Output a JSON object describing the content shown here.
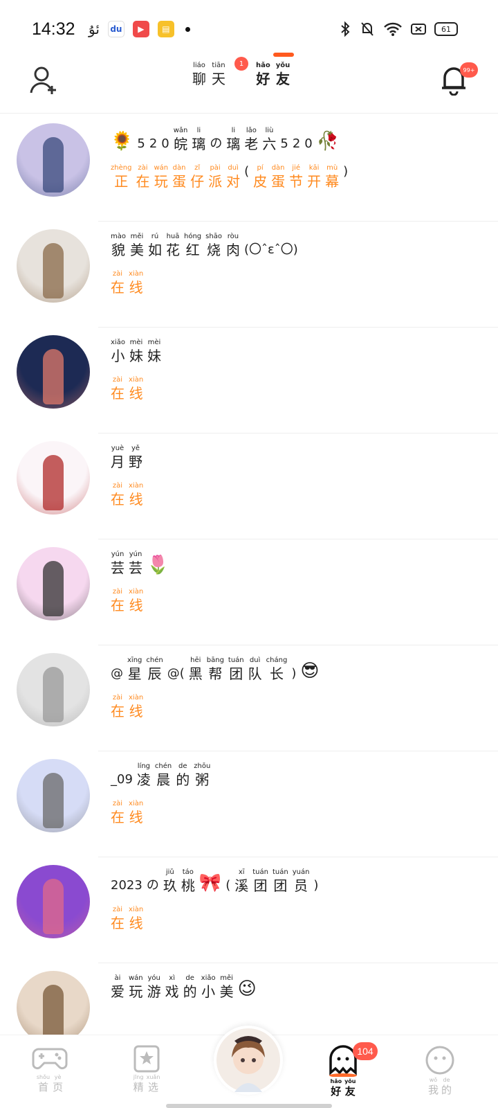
{
  "status_bar": {
    "time": "14:32",
    "left_icons": [
      "uyghur-app-icon",
      "baidu-icon",
      "video-app-icon",
      "notes-app-icon",
      "more-dot-icon"
    ],
    "right_icons": [
      "bluetooth-icon",
      "mute-bell-icon",
      "wifi-icon",
      "sim-disabled-icon"
    ],
    "battery": "61"
  },
  "header": {
    "tab_chat": [
      {
        "py": "liáo",
        "hz": "聊"
      },
      {
        "py": "tiān",
        "hz": "天"
      }
    ],
    "tab_friends": [
      {
        "py": "hǎo",
        "hz": "好"
      },
      {
        "py": "yǒu",
        "hz": "友"
      }
    ],
    "chat_badge": "1",
    "bell_badge": "99+",
    "accent": "#ff5a1f"
  },
  "friends": [
    {
      "name": [
        {
          "emoji": "🌻"
        },
        {
          "text": "5"
        },
        {
          "text": "2"
        },
        {
          "text": "0"
        },
        {
          "py": "wǎn",
          "hz": "皖"
        },
        {
          "py": "li",
          "hz": "璃"
        },
        {
          "text": "の"
        },
        {
          "py": "li",
          "hz": "璃"
        },
        {
          "py": "lǎo",
          "hz": "老"
        },
        {
          "py": "liù",
          "hz": "六"
        },
        {
          "text": "5"
        },
        {
          "text": "2"
        },
        {
          "text": "0"
        },
        {
          "emoji": "🥀"
        }
      ],
      "status": [
        {
          "py": "zhèng",
          "hz": "正"
        },
        {
          "py": "zài",
          "hz": "在"
        },
        {
          "py": "wán",
          "hz": "玩"
        },
        {
          "py": "dàn",
          "hz": "蛋"
        },
        {
          "py": "zǐ",
          "hz": "仔"
        },
        {
          "py": "pài",
          "hz": "派"
        },
        {
          "py": "duì",
          "hz": "对"
        },
        {
          "text": "("
        },
        {
          "py": "pí",
          "hz": "皮"
        },
        {
          "py": "dàn",
          "hz": "蛋"
        },
        {
          "py": "jié",
          "hz": "节"
        },
        {
          "py": "kāi",
          "hz": "开"
        },
        {
          "py": "mù",
          "hz": "幕"
        },
        {
          "text": ")"
        }
      ],
      "avatar_colors": [
        "#c9c2e6",
        "#3a4a7c"
      ]
    },
    {
      "name": [
        {
          "py": "mào",
          "hz": "貌"
        },
        {
          "py": "měi",
          "hz": "美"
        },
        {
          "py": "rú",
          "hz": "如"
        },
        {
          "py": "huā",
          "hz": "花"
        },
        {
          "py": "hóng",
          "hz": "红"
        },
        {
          "py": "shāo",
          "hz": "烧"
        },
        {
          "py": "ròu",
          "hz": "肉"
        },
        {
          "text": "(〇ˆεˆ〇)"
        }
      ],
      "status": [
        {
          "py": "zài",
          "hz": "在"
        },
        {
          "py": "xiàn",
          "hz": "线"
        }
      ],
      "avatar_colors": [
        "#e7e2dc",
        "#8a6a4a"
      ]
    },
    {
      "name": [
        {
          "py": "xiǎo",
          "hz": "小"
        },
        {
          "py": "mèi",
          "hz": "妹"
        },
        {
          "py": "mèi",
          "hz": "妹"
        }
      ],
      "status": [
        {
          "py": "zài",
          "hz": "在"
        },
        {
          "py": "xiàn",
          "hz": "线"
        }
      ],
      "avatar_colors": [
        "#1d2a54",
        "#e07a6a"
      ]
    },
    {
      "name": [
        {
          "py": "yuè",
          "hz": "月"
        },
        {
          "py": "yě",
          "hz": "野"
        }
      ],
      "status": [
        {
          "py": "zài",
          "hz": "在"
        },
        {
          "py": "xiàn",
          "hz": "线"
        }
      ],
      "avatar_colors": [
        "#fbf5f8",
        "#b02a2a"
      ]
    },
    {
      "name": [
        {
          "py": "yún",
          "hz": "芸"
        },
        {
          "py": "yún",
          "hz": "芸"
        },
        {
          "emoji": "🌷"
        }
      ],
      "status": [
        {
          "py": "zài",
          "hz": "在"
        },
        {
          "py": "xiàn",
          "hz": "线"
        }
      ],
      "avatar_colors": [
        "#f6d8ef",
        "#333333"
      ]
    },
    {
      "name": [
        {
          "text": "@"
        },
        {
          "py": "xīng",
          "hz": "星"
        },
        {
          "py": "chén",
          "hz": "辰"
        },
        {
          "text": "@("
        },
        {
          "py": "hēi",
          "hz": "黑"
        },
        {
          "py": "bāng",
          "hz": "帮"
        },
        {
          "py": "tuán",
          "hz": "团"
        },
        {
          "py": "duì",
          "hz": "队"
        },
        {
          "py": "cháng",
          "hz": "长"
        },
        {
          "text": ")"
        },
        {
          "emoji": "😎"
        }
      ],
      "status": [
        {
          "py": "zài",
          "hz": "在"
        },
        {
          "py": "xiàn",
          "hz": "线"
        }
      ],
      "avatar_colors": [
        "#e3e3e3",
        "#9a9a9a"
      ]
    },
    {
      "name": [
        {
          "text": "_09"
        },
        {
          "py": "líng",
          "hz": "凌"
        },
        {
          "py": "chén",
          "hz": "晨"
        },
        {
          "py": "de",
          "hz": "的"
        },
        {
          "py": "zhōu",
          "hz": "粥"
        }
      ],
      "status": [
        {
          "py": "zài",
          "hz": "在"
        },
        {
          "py": "xiàn",
          "hz": "线"
        }
      ],
      "avatar_colors": [
        "#d6dcf6",
        "#6a6a6a"
      ]
    },
    {
      "name": [
        {
          "text": "2023"
        },
        {
          "text": "の"
        },
        {
          "py": "jiǔ",
          "hz": "玖"
        },
        {
          "py": "táo",
          "hz": "桃"
        },
        {
          "emoji": "🎀"
        },
        {
          "text": "("
        },
        {
          "py": "xī",
          "hz": "溪"
        },
        {
          "py": "tuán",
          "hz": "团"
        },
        {
          "py": "tuán",
          "hz": "团"
        },
        {
          "py": "yuán",
          "hz": "员"
        },
        {
          "text": ")"
        }
      ],
      "status": [
        {
          "py": "zài",
          "hz": "在"
        },
        {
          "py": "xiàn",
          "hz": "线"
        }
      ],
      "avatar_colors": [
        "#8a4ad0",
        "#e06a8a"
      ]
    },
    {
      "name": [
        {
          "py": "ài",
          "hz": "爱"
        },
        {
          "py": "wán",
          "hz": "玩"
        },
        {
          "py": "yóu",
          "hz": "游"
        },
        {
          "py": "xì",
          "hz": "戏"
        },
        {
          "py": "de",
          "hz": "的"
        },
        {
          "py": "xiǎo",
          "hz": "小"
        },
        {
          "py": "měi",
          "hz": "美"
        },
        {
          "emoji": "😉"
        }
      ],
      "status": [],
      "avatar_colors": [
        "#e8d8c8",
        "#7a5a3a"
      ]
    }
  ],
  "bottom_nav": {
    "items": [
      {
        "icon": "gamepad-icon",
        "label": [
          {
            "py": "shǒu",
            "hz": "首"
          },
          {
            "py": "yè",
            "hz": "页"
          }
        ],
        "active": false
      },
      {
        "icon": "star-card-icon",
        "label": [
          {
            "py": "jīng",
            "hz": "精"
          },
          {
            "py": "xuǎn",
            "hz": "选"
          }
        ],
        "active": false
      },
      {
        "icon": "ghost-icon",
        "label": [
          {
            "py": "hǎo",
            "hz": "好"
          },
          {
            "py": "yǒu",
            "hz": "友"
          }
        ],
        "active": true
      },
      {
        "icon": "smiley-icon",
        "label": [
          {
            "py": "wǒ",
            "hz": "我"
          },
          {
            "py": "de",
            "hz": "的"
          }
        ],
        "active": false
      }
    ],
    "friends_badge": "104"
  }
}
